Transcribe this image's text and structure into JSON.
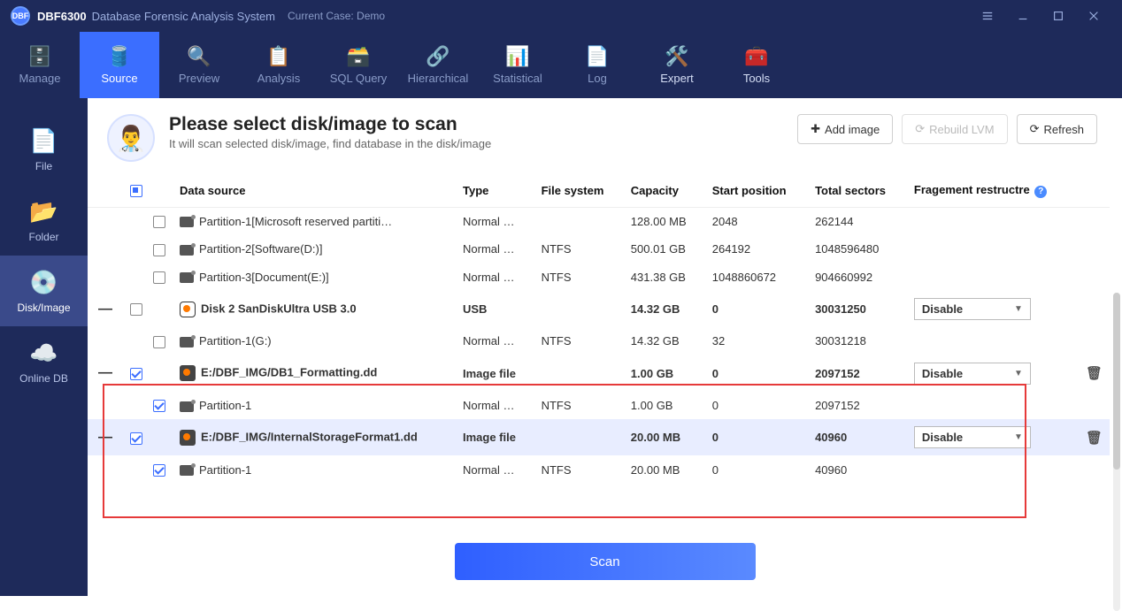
{
  "title": {
    "app": "DBF6300",
    "suffix": "Database Forensic Analysis System",
    "case_label": "Current Case: Demo"
  },
  "ribbon": [
    "Manage",
    "Source",
    "Preview",
    "Analysis",
    "SQL Query",
    "Hierarchical",
    "Statistical",
    "Log",
    "Expert",
    "Tools"
  ],
  "sidebar": [
    "File",
    "Folder",
    "Disk/Image",
    "Online DB"
  ],
  "header": {
    "title": "Please select disk/image to scan",
    "subtitle": "It will scan selected disk/image, find database in the disk/image",
    "add": "Add image",
    "rebuild": "Rebuild LVM",
    "refresh": "Refresh"
  },
  "columns": [
    "Data source",
    "Type",
    "File system",
    "Capacity",
    "Start position",
    "Total sectors",
    "Fragement restructre"
  ],
  "rows": [
    {
      "level": 1,
      "checked": false,
      "icon": "part",
      "name": "Partition-1[Microsoft reserved partiti…",
      "type": "Normal …",
      "fs": "",
      "cap": "128.00 MB",
      "start": "2048",
      "sec": "262144"
    },
    {
      "level": 1,
      "checked": false,
      "icon": "part",
      "name": "Partition-2[Software(D:)]",
      "type": "Normal …",
      "fs": "NTFS",
      "cap": "500.01 GB",
      "start": "264192",
      "sec": "1048596480"
    },
    {
      "level": 1,
      "checked": false,
      "icon": "part",
      "name": "Partition-3[Document(E:)]",
      "type": "Normal …",
      "fs": "NTFS",
      "cap": "431.38 GB",
      "start": "1048860672",
      "sec": "904660992"
    },
    {
      "level": 0,
      "expand": true,
      "checked": false,
      "icon": "disk",
      "name": "Disk 2 SanDiskUltra USB 3.0",
      "type": "USB",
      "fs": "",
      "cap": "14.32 GB",
      "start": "0",
      "sec": "30031250",
      "frag": "Disable"
    },
    {
      "level": 1,
      "checked": false,
      "icon": "part",
      "name": "Partition-1(G:)",
      "type": "Normal …",
      "fs": "NTFS",
      "cap": "14.32 GB",
      "start": "32",
      "sec": "30031218"
    },
    {
      "level": 0,
      "expand": true,
      "checked": true,
      "icon": "img",
      "name": "E:/DBF_IMG/DB1_Formatting.dd",
      "type": "Image file",
      "fs": "",
      "cap": "1.00 GB",
      "start": "0",
      "sec": "2097152",
      "frag": "Disable",
      "del": true
    },
    {
      "level": 1,
      "checked": true,
      "icon": "part",
      "name": "Partition-1",
      "type": "Normal …",
      "fs": "NTFS",
      "cap": "1.00 GB",
      "start": "0",
      "sec": "2097152"
    },
    {
      "level": 0,
      "expand": true,
      "checked": true,
      "icon": "img",
      "name": "E:/DBF_IMG/InternalStorageFormat1.dd",
      "type": "Image file",
      "fs": "",
      "cap": "20.00 MB",
      "start": "0",
      "sec": "40960",
      "frag": "Disable",
      "del": true,
      "hl": true
    },
    {
      "level": 1,
      "checked": true,
      "icon": "part",
      "name": "Partition-1",
      "type": "Normal …",
      "fs": "NTFS",
      "cap": "20.00 MB",
      "start": "0",
      "sec": "40960"
    }
  ],
  "scan": "Scan"
}
